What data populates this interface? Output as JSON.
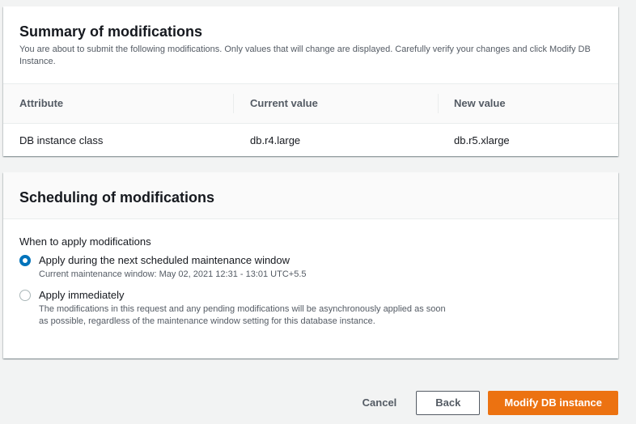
{
  "summary": {
    "title": "Summary of modifications",
    "description": "You are about to submit the following modifications. Only values that will change are displayed. Carefully verify your changes and click Modify DB Instance.",
    "columns": [
      "Attribute",
      "Current value",
      "New value"
    ],
    "rows": [
      {
        "attribute": "DB instance class",
        "current": "db.r4.large",
        "new": "db.r5.xlarge"
      }
    ]
  },
  "scheduling": {
    "title": "Scheduling of modifications",
    "field_label": "When to apply modifications",
    "options": [
      {
        "label": "Apply during the next scheduled maintenance window",
        "description": "Current maintenance window: May 02, 2021 12:31 - 13:01 UTC+5.5",
        "checked": true
      },
      {
        "label": "Apply immediately",
        "description": "The modifications in this request and any pending modifications will be asynchronously applied as soon as possible, regardless of the maintenance window setting for this database instance.",
        "checked": false
      }
    ]
  },
  "actions": {
    "cancel": "Cancel",
    "back": "Back",
    "primary": "Modify DB instance"
  },
  "colors": {
    "primary_button": "#ec7211",
    "radio_selected": "#0073bb"
  }
}
